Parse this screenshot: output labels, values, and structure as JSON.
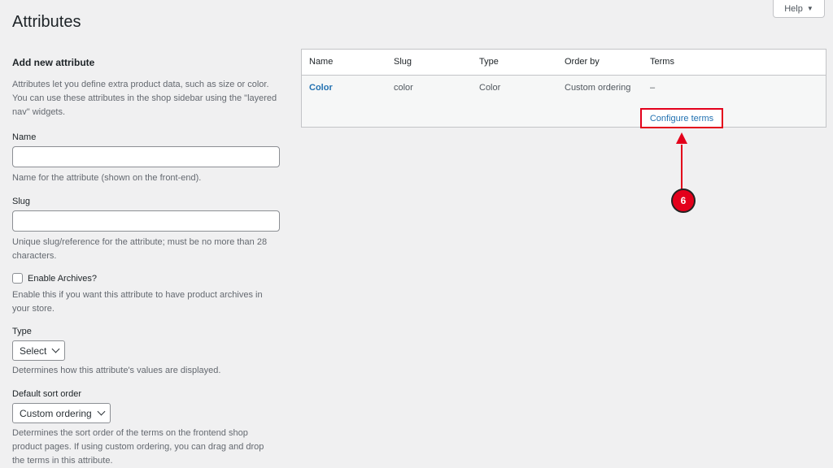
{
  "header": {
    "title": "Attributes",
    "help_label": "Help",
    "help_caret": "▼"
  },
  "form": {
    "section_title": "Add new attribute",
    "intro": "Attributes let you define extra product data, such as size or color. You can use these attributes in the shop sidebar using the \"layered nav\" widgets.",
    "name": {
      "label": "Name",
      "value": "",
      "help": "Name for the attribute (shown on the front-end)."
    },
    "slug": {
      "label": "Slug",
      "value": "",
      "help": "Unique slug/reference for the attribute; must be no more than 28 characters."
    },
    "archives": {
      "label": "Enable Archives?",
      "checked": false,
      "help": "Enable this if you want this attribute to have product archives in your store."
    },
    "type": {
      "label": "Type",
      "selected": "Select",
      "help": "Determines how this attribute's values are displayed."
    },
    "sort": {
      "label": "Default sort order",
      "selected": "Custom ordering",
      "help": "Determines the sort order of the terms on the frontend shop product pages. If using custom ordering, you can drag and drop the terms in this attribute."
    }
  },
  "table": {
    "headers": [
      "Name",
      "Slug",
      "Type",
      "Order by",
      "Terms"
    ],
    "rows": [
      {
        "name": "Color",
        "slug": "color",
        "type": "Color",
        "order_by": "Custom ordering",
        "terms": "–",
        "action": "Configure terms"
      }
    ]
  },
  "annotation": {
    "step": "6",
    "color": "#e3001b"
  },
  "colors": {
    "link": "#2271b1",
    "background": "#f0f0f1"
  }
}
